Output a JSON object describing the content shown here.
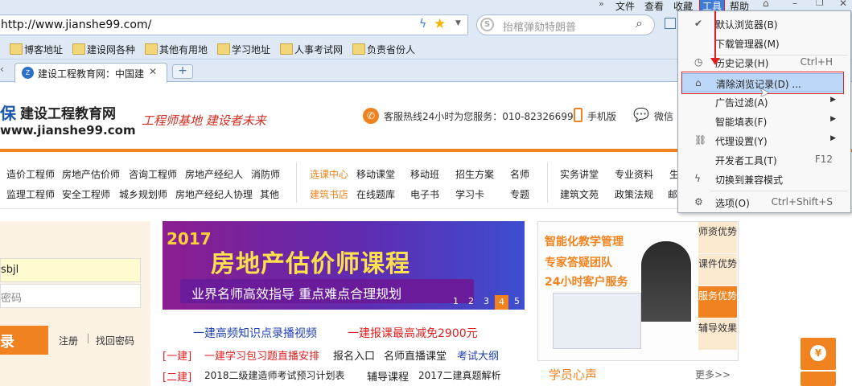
{
  "menubar": {
    "items": [
      "文件",
      "查看",
      "收藏",
      "工具",
      "帮助"
    ]
  },
  "address": {
    "url": "http://www.jianshe99.com/",
    "search_placeholder": "抬棺弹劾特朗普"
  },
  "bookmarks": [
    "博客地址",
    "建设网各种",
    "其他有用地",
    "学习地址",
    "人事考试网",
    "负责省份人"
  ],
  "tab": {
    "title": "建设工程教育网：中国建"
  },
  "site": {
    "logo_cn": "建设工程教育网",
    "logo_prefix": "保",
    "logo_url": "www.jianshe99.com",
    "slogan": "工程师基地 建设者未来",
    "hotline": "客服热线24小时为您服务：010-82326699",
    "mobile": "手机版",
    "wechat": "微信"
  },
  "nav": {
    "col1": [
      "造价工程师",
      "房地产估价师",
      "咨询工程师",
      "房地产经纪人",
      "消防师",
      "监理工程师",
      "安全工程师",
      "城乡规划师",
      "房地产经纪人协理",
      "其他"
    ],
    "col2": [
      "选课中心",
      "移动课堂",
      "移动班",
      "招生方案",
      "名师",
      "建筑书店",
      "在线题库",
      "电子书",
      "学习卡",
      "专题"
    ],
    "col3": [
      "实务讲堂",
      "专业资料",
      "生",
      "建筑文苑",
      "政策法规",
      "邮"
    ]
  },
  "login": {
    "username": "sbjl",
    "password_placeholder": "密码",
    "login_btn": "录",
    "register": "注册",
    "forgot": "找回密码"
  },
  "banner": {
    "year": "2017",
    "title": "房地产估价师课程",
    "subtitle": "业界名师高效指导  重点难点合理规划",
    "pages": [
      "1",
      "2",
      "3",
      "4",
      "5"
    ]
  },
  "news": [
    {
      "tag": "",
      "a": "一建高频知识点录播视频",
      "b": "一建报课最高减免2900元"
    },
    {
      "tag": "[一建]",
      "a": "一建学习包习题直播安排",
      "b": "报名入口",
      "c": "名师直播课堂",
      "d": "考试大纲"
    },
    {
      "tag": "[二建]",
      "a": "2018二级建造师考试预习计划表",
      "b": "辅导课程",
      "c": "2017二建真题解析"
    }
  ],
  "promo": {
    "lines": [
      "智能化教学管理",
      "专家答疑团队",
      "24小时客户服务"
    ],
    "tabs": [
      "师资优势",
      "课件优势",
      "服务优势",
      "辅导效果"
    ]
  },
  "students": {
    "title": "学员心声",
    "more": "更多>>"
  },
  "float": {
    "yen": "¥"
  },
  "menu": {
    "items": [
      {
        "label": "默认浏览器(B)",
        "shortcut": "",
        "icon": "check-icon"
      },
      {
        "label": "下载管理器(M)",
        "shortcut": "",
        "icon": ""
      },
      {
        "label": "历史记录(H)",
        "shortcut": "Ctrl+H",
        "icon": "clock-icon"
      },
      {
        "label": "清除浏览记录(D) ...",
        "shortcut": "",
        "icon": "eraser-icon"
      },
      {
        "label": "广告过滤(A)",
        "shortcut": "",
        "icon": ""
      },
      {
        "label": "智能填表(F)",
        "shortcut": "",
        "icon": ""
      },
      {
        "label": "代理设置(Y)",
        "shortcut": "",
        "icon": "link-icon"
      },
      {
        "label": "开发者工具(T)",
        "shortcut": "F12",
        "icon": ""
      },
      {
        "label": "切换到兼容模式",
        "shortcut": "",
        "icon": "bolt-icon"
      },
      {
        "label": "选项(O)",
        "shortcut": "Ctrl+Shift+S",
        "icon": "gear-icon"
      }
    ]
  },
  "colors": {
    "accent": "#f0831f",
    "brand_blue": "#1a56b0",
    "red": "#e02020"
  }
}
